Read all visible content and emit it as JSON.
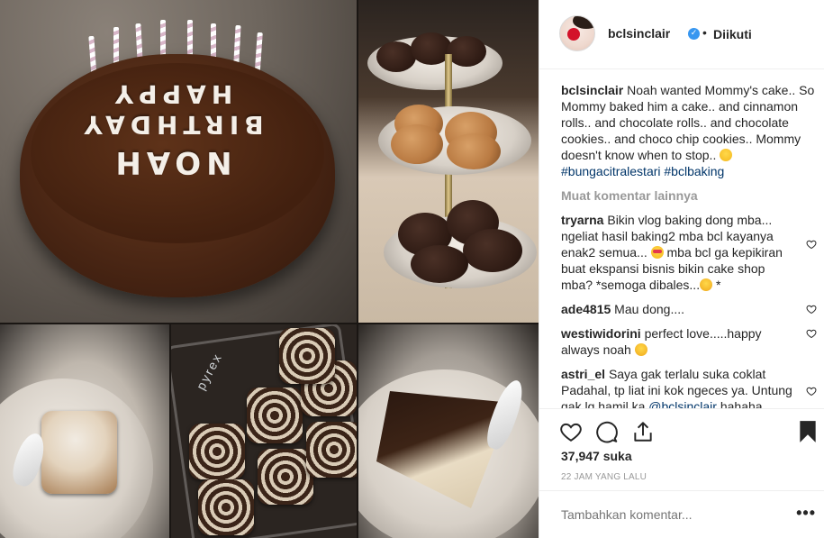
{
  "post": {
    "username": "bclsinclair",
    "separator": "•",
    "follow_status": "Diikuti",
    "cake_letters": {
      "row1": "HAPPY",
      "row2": "BIRTHDAY",
      "row3": "NOAH"
    },
    "tray_brand": "pyrex"
  },
  "caption": {
    "username": "bclsinclair",
    "text": "Noah wanted Mommy's cake.. So Mommy baked him a cake.. and cinnamon rolls.. and chocolate rolls.. and chocolate cookies.. and choco chip cookies.. Mommy doesn't know when to stop..",
    "hashtags": "#bungacitralestari #bclbaking"
  },
  "load_more": "Muat komentar lainnya",
  "comments": [
    {
      "username": "tryarna",
      "text": "Bikin vlog baking dong mba... ngeliat hasil baking2 mba bcl kayanya enak2 semua...",
      "text2": "mba bcl ga kepikiran buat ekspansi bisnis bikin cake shop mba? *semoga dibales...",
      "text3": "*"
    },
    {
      "username": "ade4815",
      "text": "Mau dong...."
    },
    {
      "username": "westiwidorini",
      "text": "perfect love.....happy always noah"
    },
    {
      "username": "astri_el",
      "text": "Saya gak terlalu suka coklat Padahal, tp liat ini kok ngeces ya. Untung gak lg hamil ka",
      "mention": "@bclsinclair",
      "tail": "hahaha"
    }
  ],
  "likes": "37,947 suka",
  "timestamp": "22 JAM YANG LALU",
  "add_comment": {
    "placeholder": "Tambahkan komentar..."
  },
  "more_options": "•••",
  "colors": {
    "link": "#003569",
    "verified": "#3897f0",
    "muted": "#999999"
  },
  "icons": [
    "heart-icon",
    "comment-icon",
    "share-icon",
    "bookmark-icon",
    "verified-icon",
    "more-icon"
  ]
}
